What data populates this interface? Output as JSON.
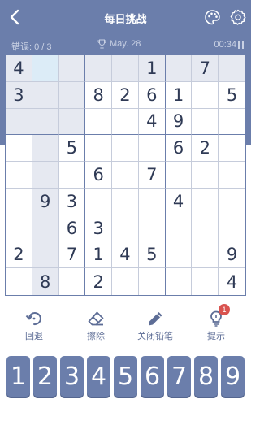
{
  "header": {
    "title": "每日挑战"
  },
  "status": {
    "errors": "错误: 0 / 3",
    "date": "May. 28",
    "timer": "00:34"
  },
  "board": {
    "grid": [
      [
        "4",
        "",
        "",
        "",
        "",
        "1",
        "",
        "7",
        ""
      ],
      [
        "3",
        "",
        "",
        "8",
        "2",
        "6",
        "1",
        "",
        "5"
      ],
      [
        "",
        "",
        "",
        "",
        "",
        "4",
        "9",
        "",
        ""
      ],
      [
        "",
        "",
        "5",
        "",
        "",
        "",
        "6",
        "2",
        ""
      ],
      [
        "",
        "",
        "",
        "6",
        "",
        "7",
        "",
        "",
        ""
      ],
      [
        "",
        "9",
        "3",
        "",
        "",
        "",
        "4",
        "",
        ""
      ],
      [
        "",
        "",
        "6",
        "3",
        "",
        "",
        "",
        "",
        ""
      ],
      [
        "2",
        "",
        "7",
        "1",
        "4",
        "5",
        "",
        "",
        "9"
      ],
      [
        "",
        "8",
        "",
        "2",
        "",
        "",
        "",
        "",
        "4"
      ]
    ],
    "selected": [
      0,
      1
    ]
  },
  "tools": {
    "undo": "回退",
    "erase": "擦除",
    "pencil": "关闭铅笔",
    "hint": "提示",
    "hint_count": "1"
  },
  "numpad": [
    "1",
    "2",
    "3",
    "4",
    "5",
    "6",
    "7",
    "8",
    "9"
  ],
  "colors": {
    "primary": "#6b7eab",
    "highlight": "#e6e9f1",
    "selected": "#dcecf7",
    "badge": "#d9534f"
  }
}
